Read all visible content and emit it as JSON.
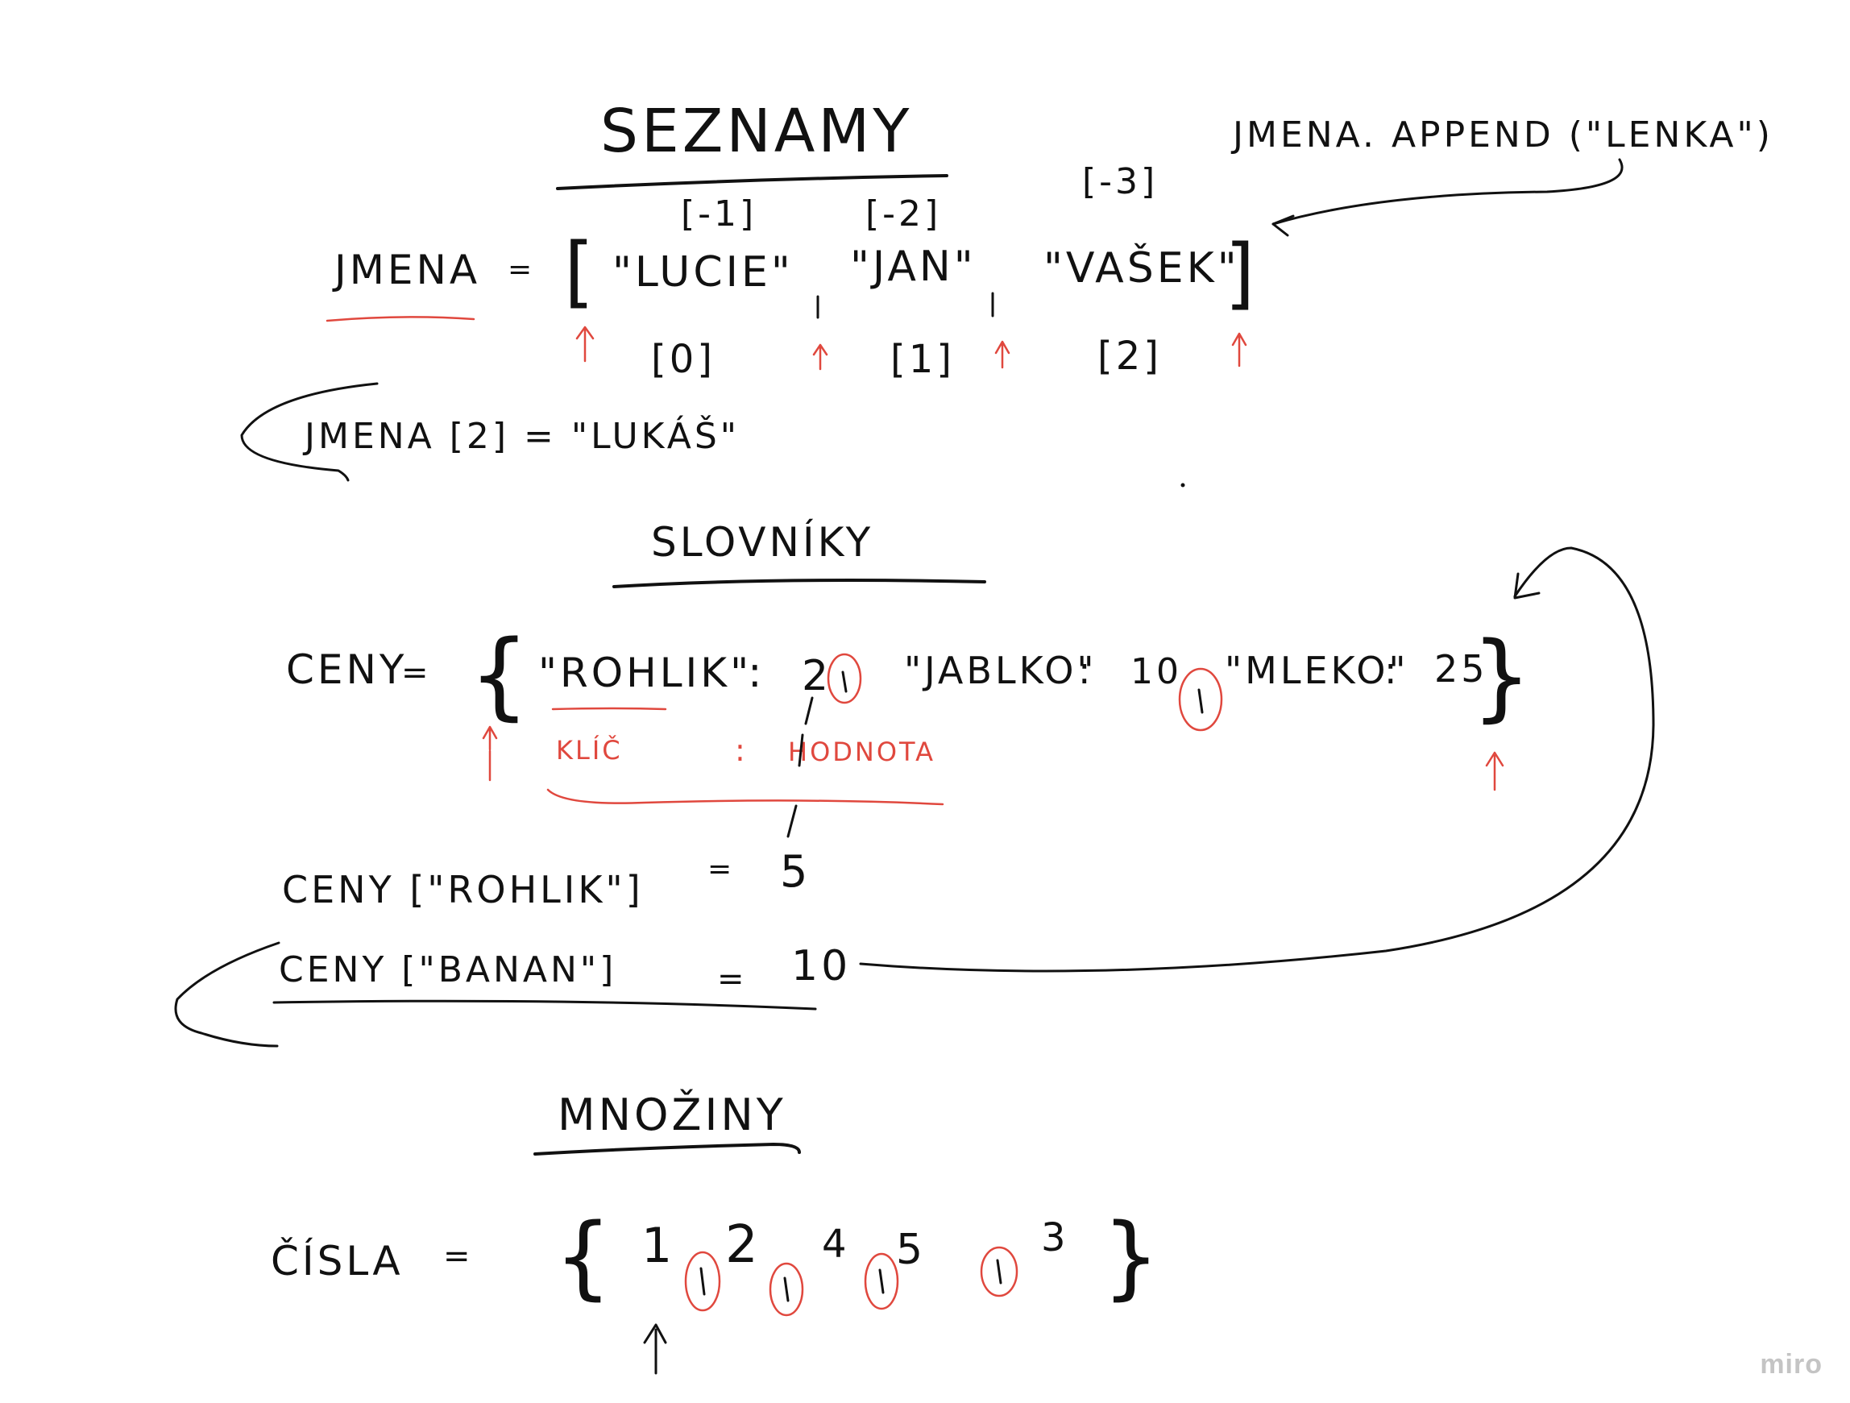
{
  "colors": {
    "ink": "#111111",
    "annotation": "#e0483e",
    "watermark": "#c4c4c4"
  },
  "seznamy": {
    "heading": "SEZNAMY",
    "assignment": {
      "name": "JMENA",
      "op": "=",
      "open": "[",
      "items": [
        "\"LUCIE\"",
        "\"JAN\"",
        "\"VAŠEK\""
      ],
      "close": "]"
    },
    "neg_indices": [
      "[-3]",
      "[-2]",
      "[-1]"
    ],
    "pos_indices": [
      "[0]",
      "[1]",
      "[2]"
    ],
    "append_call": "JMENA. APPEND (\"LENKA\")",
    "reassign": "JMENA [2] = \"LUKÁŠ\""
  },
  "slovniky": {
    "heading": "SLOVNÍKY",
    "assignment": {
      "name": "CENY",
      "op": "=",
      "open": "{",
      "close": "}"
    },
    "pairs": [
      {
        "key": "\"ROHLIK\"",
        "colon": ":",
        "value": "2"
      },
      {
        "key": "\"JABLKO\"",
        "colon": ":",
        "value": "10"
      },
      {
        "key": "\"MLEKO\"",
        "colon": ":",
        "value": "25"
      }
    ],
    "legend": {
      "key_label": "KLÍČ",
      "colon": ":",
      "value_label": "HODNOTA"
    },
    "update": {
      "text": "CENY [\"ROHLIK\"]",
      "op": "=",
      "value": "5"
    },
    "insert": {
      "text": "CENY [\"BANAN\"]",
      "op": "=",
      "value": "10"
    }
  },
  "mnoziny": {
    "heading": "MNOŽINY",
    "assignment": {
      "name": "ČÍSLA",
      "op": "=",
      "open": "{",
      "close": "}"
    },
    "items": [
      "1",
      "2",
      "4",
      "5",
      "3"
    ]
  },
  "watermark": "miro"
}
